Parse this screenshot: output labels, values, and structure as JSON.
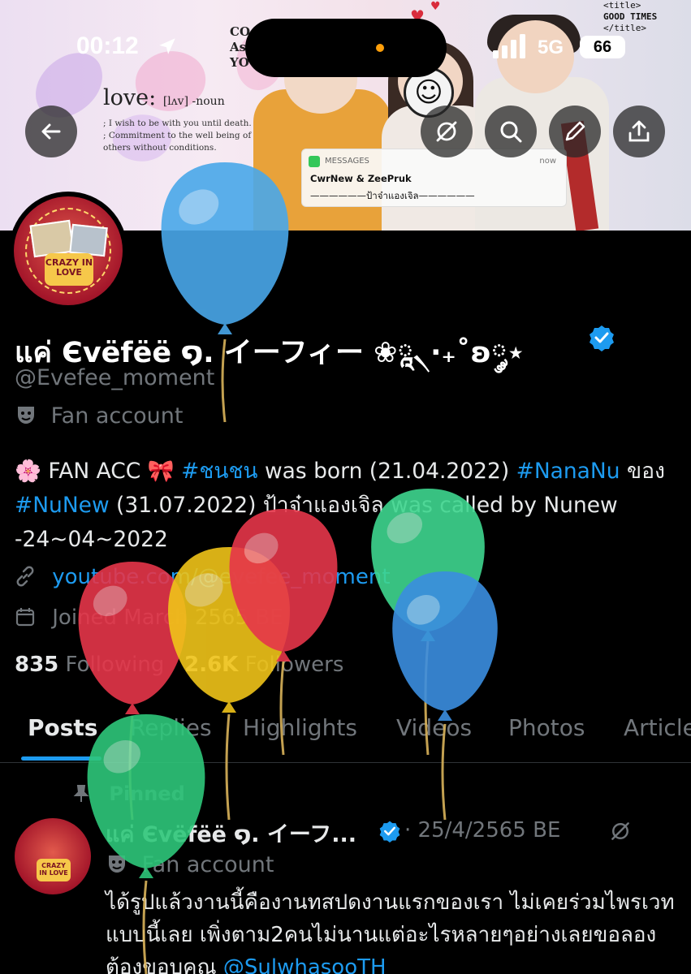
{
  "status_bar": {
    "time": "00:12",
    "network": "5G",
    "battery": "66"
  },
  "banner": {
    "love_word": "love:",
    "love_pron": "[lʌv] -noun",
    "love_def": "; I wish to be with you until death.\n; Commitment to the well being of others without conditions.",
    "concert_title": "CO\nAs\nYOU",
    "code_open": "<title>",
    "code_text": "GOOD TIMES",
    "code_close": "</title>",
    "notification": {
      "app": "MESSAGES",
      "time": "now",
      "sender": "CwrNew & ZeePruk",
      "body": "——————ป้าจ๋าแองเจิล——————"
    }
  },
  "avatar_badge": "CRAZY IN LOVE",
  "profile": {
    "display_name": "แค่ Єvëfëë ໑. イーフィー ❀ཱ৲·₊˚ʚ༘⋆",
    "handle": "@Evefee_moment",
    "category": "Fan account",
    "bio_emoji1": "🌸",
    "bio_1": " FAN ACC ",
    "bio_emoji2": "🎀",
    "bio_tag1": "#ชนชน",
    "bio_2": " was born (21.04.2022) ",
    "bio_tag2": "#NanaNu",
    "bio_3": " ของ ",
    "bio_tag3": "#NuNew",
    "bio_4": " (31.07.2022) ป้าจ๋าแองเจิล was called by Nunew -24~04~2022",
    "link": "youtube.com/@evefee_moment",
    "joined": "Joined March 2565 BE",
    "following_count": "835",
    "following_label": "Following",
    "followers_count": "2.6K",
    "followers_label": "Followers"
  },
  "tabs": [
    "Posts",
    "Replies",
    "Highlights",
    "Videos",
    "Photos",
    "Articles"
  ],
  "pinned_post": {
    "pinned_label": "Pinned",
    "name": "แค่ Єvëfëë ໑. イーフ...",
    "date": "· 25/4/2565 BE",
    "category": "Fan account",
    "text_1": "ได้รูปแล้วงานนี้คืองานทสปดงานแรกของเรา ไม่เคยร่วมไพรเวทแบบนี้เลย เพิ่งตาม2คนไม่นานแต่อะไรหลายๆอย่างเลยขอลอง ต้องขอบคุณ ",
    "mention": "@SulwhasooTH"
  },
  "colors": {
    "accent": "#1d9bf0",
    "muted": "#71767b",
    "text": "#e7e9ea",
    "background": "#000000"
  },
  "balloons": [
    {
      "color": "#4aa8ea"
    },
    {
      "color": "#e6364a"
    },
    {
      "color": "#f0c419"
    },
    {
      "color": "#e6364a"
    },
    {
      "color": "#3fd68f"
    },
    {
      "color": "#3b8ee0"
    },
    {
      "color": "#2ec77a"
    }
  ]
}
